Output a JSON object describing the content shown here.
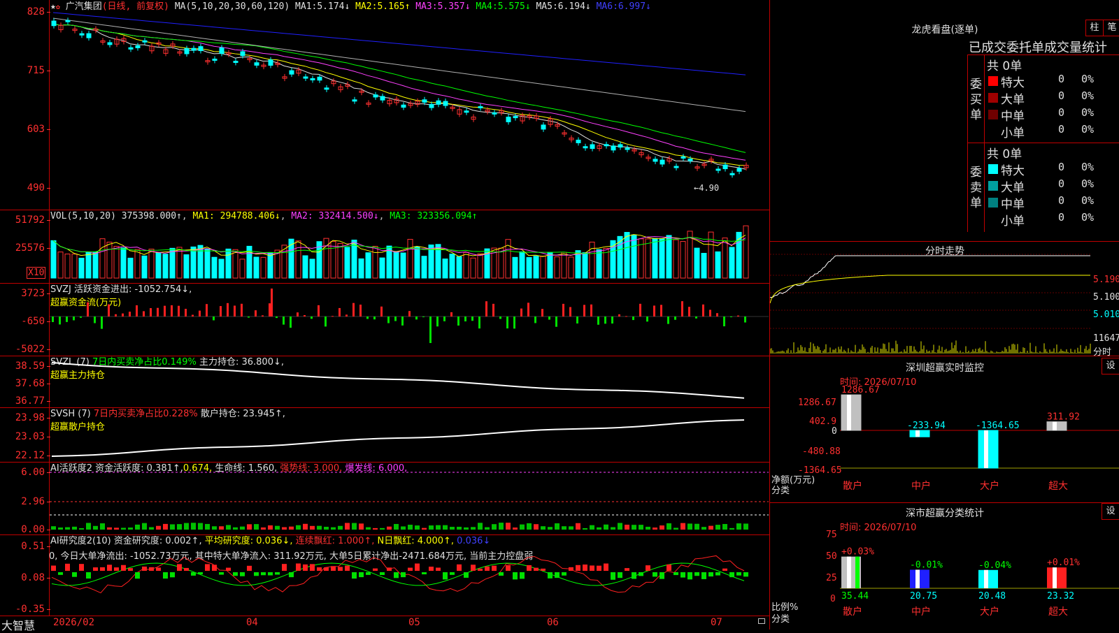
{
  "main": {
    "stock_name": "广汽集团",
    "mode": "(日线, 前复权)",
    "ma_params": "MA(5,10,20,30,60,120)",
    "ma": [
      {
        "label": "MA1:",
        "value": "5.174↓",
        "color": "#e0e0e0"
      },
      {
        "label": "MA2:",
        "value": "5.165↑",
        "color": "#ffff00"
      },
      {
        "label": "MA3:",
        "value": "5.357↓",
        "color": "#ff40ff"
      },
      {
        "label": "MA4:",
        "value": "5.575↓",
        "color": "#00ff00"
      },
      {
        "label": "MA5:",
        "value": "6.194↓",
        "color": "#e0e0e0"
      },
      {
        "label": "MA6:",
        "value": "6.997↓",
        "color": "#4040ff"
      }
    ],
    "yticks": [
      "828",
      "715",
      "603",
      "490"
    ],
    "low_marker": "←4.90"
  },
  "vol": {
    "params": "VOL(5,10,20)",
    "value": "375398.000↑",
    "ma1": "MA1: 294788.406↓",
    "ma2": "MA2: 332414.500↓",
    "ma3": "MA3: 323356.094↑",
    "yticks": [
      "51792",
      "25576"
    ],
    "unit": "X10"
  },
  "svzj": {
    "title": "SVZJ  活跃资金进出: -1052.754↓,",
    "sub": "超赢资金流(万元)",
    "yticks": [
      "3723",
      "-650",
      "-5022"
    ]
  },
  "svzl": {
    "name": "SVZL (7)",
    "part1": "7日内买卖净占比0.149%",
    "part2": "主力持仓: 36.800↓,",
    "sub": "超赢主力持仓",
    "yticks": [
      "38.59",
      "37.68",
      "36.77"
    ]
  },
  "svsh": {
    "name": "SVSH (7)",
    "part1": "7日内买卖净占比0.228%",
    "part2": "散户持仓: 23.945↑,",
    "sub": "超赢散户持仓",
    "yticks": [
      "23.98",
      "23.03",
      "22.12"
    ]
  },
  "ai1": {
    "name": "AI活跃度2",
    "v1": "资金活跃度: 0.381↑,",
    "v2": "0.674,",
    "v3": "生命线: 1.560,",
    "v4": "强势线: 3.000,",
    "v5": "爆发线: 6.000,",
    "yticks": [
      "6.00",
      "2.96",
      "0.00"
    ]
  },
  "ai2": {
    "name": "AI研究度2(10)",
    "v1": "资金研究度: 0.002↑,",
    "v2": "平均研究度: 0.036↓,",
    "v3": "连续飘红: 1.000↑,",
    "v4": "N日飘红: 4.000↑,",
    "v5": "0.036↓",
    "line2": "0, 今日大单净流出: -1052.73万元, 其中特大单净流入: 311.92万元, 大单5日累计净出-2471.684万元, 当前主力控盘弱",
    "yticks": [
      "0.51",
      "0.08",
      "-0.35"
    ]
  },
  "xaxis": {
    "brand": "大智慧",
    "labels": [
      "2026/02",
      "04",
      "05",
      "06",
      "07"
    ]
  },
  "lhb": {
    "title": "龙虎看盘(逐单)",
    "btn1": "柱",
    "btn2": "笔",
    "header": "已成交委托单成交量统计",
    "buy_label": "委买单",
    "sell_label": "委卖单",
    "buy_total": "共 0单",
    "sell_total": "共 0单",
    "buy_rows": [
      {
        "name": "特大",
        "count": "0",
        "pct": "0%",
        "color": "#ff0000"
      },
      {
        "name": "大单",
        "count": "0",
        "pct": "0%",
        "color": "#a00000"
      },
      {
        "name": "中单",
        "count": "0",
        "pct": "0%",
        "color": "#700000"
      },
      {
        "name": "小单",
        "count": "0",
        "pct": "0%",
        "color": ""
      }
    ],
    "sell_rows": [
      {
        "name": "特大",
        "count": "0",
        "pct": "0%",
        "color": "#00ffff"
      },
      {
        "name": "大单",
        "count": "0",
        "pct": "0%",
        "color": "#00a0a0"
      },
      {
        "name": "中单",
        "count": "0",
        "pct": "0%",
        "color": "#008080"
      },
      {
        "name": "小单",
        "count": "0",
        "pct": "0%",
        "color": ""
      }
    ]
  },
  "intraday": {
    "title": "分时走势",
    "yticks": [
      "5.190",
      "5.100",
      "5.010"
    ],
    "vol_label": "11647",
    "vol_sub": "分时"
  },
  "monitor": {
    "title": "深圳超赢实时监控",
    "btn": "设",
    "time": "时间: 2026/07/10",
    "yticks": [
      "1286.67",
      "402.9",
      "0",
      "-480.88",
      "-1364.65"
    ],
    "unit1": "净额(万元)",
    "unit2": "分类",
    "bars": [
      {
        "name": "散户",
        "value": "1286.67"
      },
      {
        "name": "中户",
        "value": "-233.94"
      },
      {
        "name": "大户",
        "value": "-1364.65"
      },
      {
        "name": "超大",
        "value": "311.92"
      }
    ]
  },
  "stats": {
    "title": "深市超赢分类统计",
    "btn": "设",
    "time": "时间: 2026/07/10",
    "yticks": [
      "75",
      "50",
      "25",
      "0"
    ],
    "unit1": "比例%",
    "unit2": "分类",
    "bars": [
      {
        "name": "散户",
        "value": "35.44",
        "delta": "+0.03%"
      },
      {
        "name": "中户",
        "value": "20.75",
        "delta": "-0.01%"
      },
      {
        "name": "大户",
        "value": "20.48",
        "delta": "-0.04%"
      },
      {
        "name": "超大",
        "value": "23.32",
        "delta": "+0.01%"
      }
    ]
  }
}
